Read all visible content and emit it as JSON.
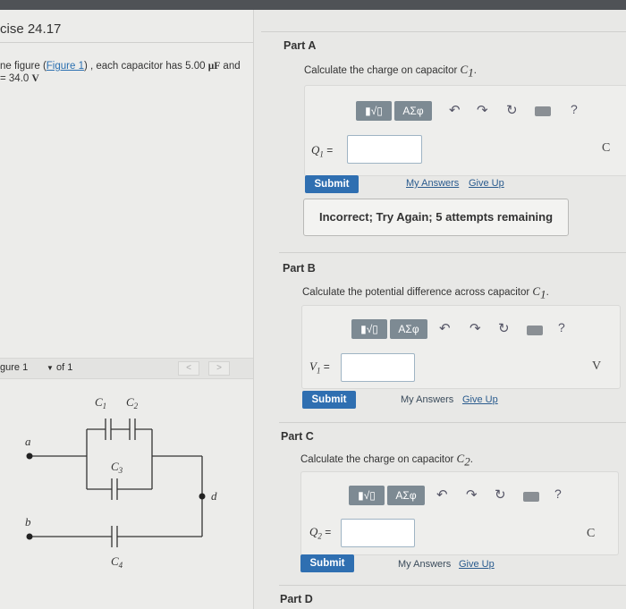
{
  "exercise": {
    "title": "cise 24.17"
  },
  "intro": {
    "prefix": "ne figure (",
    "figure_link": "Figure 1",
    "middle": ") , each capacitor has 5.00 ",
    "cap_unit": "μF",
    "suffix": " and",
    "line2_prefix": "= 34.0 ",
    "volt_unit": "V"
  },
  "figure_nav": {
    "label": "gure 1",
    "selector": "of 1",
    "prev": "<",
    "next": ">"
  },
  "circuit": {
    "labels": {
      "C1": "C",
      "C2": "C",
      "C3": "C",
      "C4": "C",
      "a": "a",
      "b": "b",
      "d": "d"
    },
    "subs": {
      "C1": "1",
      "C2": "2",
      "C3": "3",
      "C4": "4"
    }
  },
  "toolbar": {
    "templates": "▮√▯",
    "symbols": "ΑΣφ",
    "help": "?"
  },
  "parts": {
    "a": {
      "heading": "Part A",
      "prompt": "Calculate the charge on capacitor ",
      "sym": "C",
      "sub": "1",
      "end": ".",
      "var": "Q",
      "var_sub": "1",
      "eq": " =",
      "value": "",
      "unit": "C",
      "submit": "Submit",
      "my_answers": "My Answers",
      "give_up": "Give Up",
      "feedback": "Incorrect; Try Again; 5 attempts remaining"
    },
    "b": {
      "heading": "Part B",
      "prompt": "Calculate the potential difference across capacitor ",
      "sym": "C",
      "sub": "1",
      "end": ".",
      "var": "V",
      "var_sub": "1",
      "eq": " =",
      "value": "",
      "unit": "V",
      "submit": "Submit",
      "my_answers": "My Answers",
      "give_up": "Give Up"
    },
    "c": {
      "heading": "Part C",
      "prompt": "Calculate the charge on capacitor ",
      "sym": "C",
      "sub": "2",
      "end": ".",
      "var": "Q",
      "var_sub": "2",
      "eq": " =",
      "value": "",
      "unit": "C",
      "submit": "Submit",
      "my_answers": "My Answers",
      "give_up": "Give Up"
    },
    "d": {
      "heading": "Part D"
    }
  }
}
